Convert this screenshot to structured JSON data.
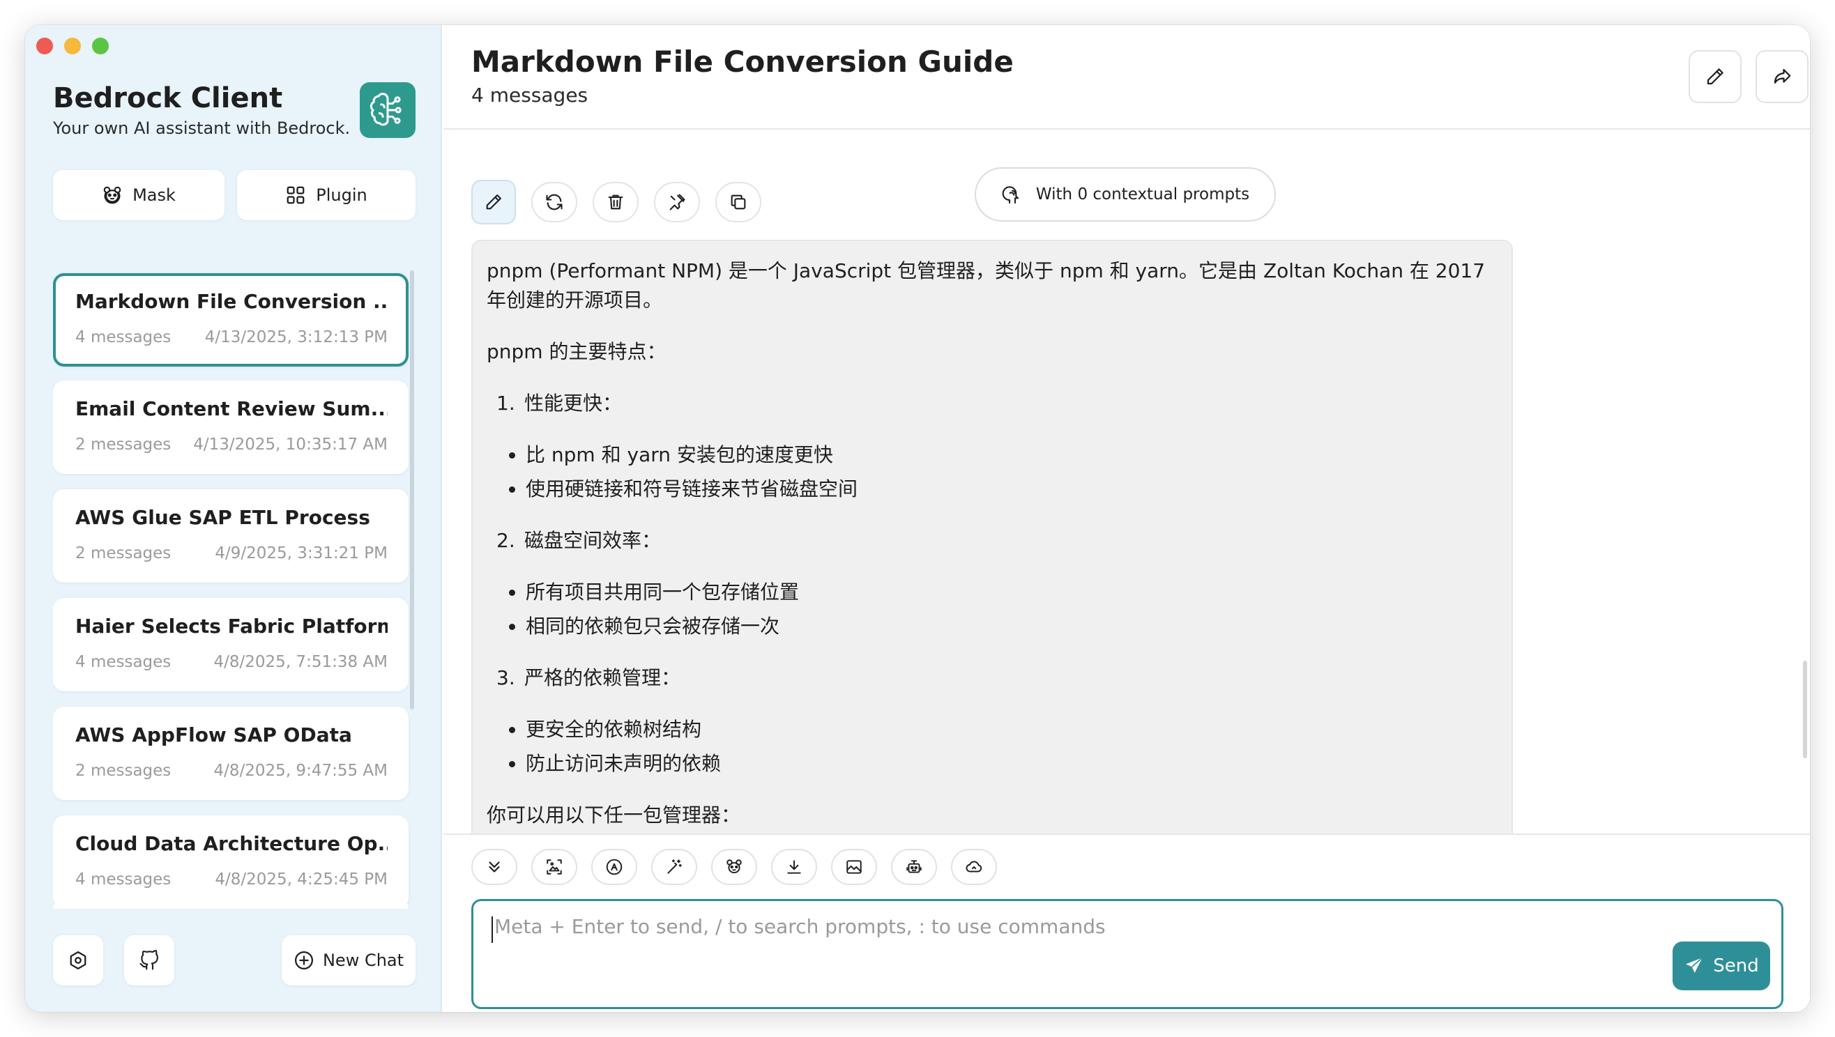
{
  "app": {
    "title": "Bedrock Client",
    "subtitle": "Your own AI assistant with Bedrock."
  },
  "sidebar": {
    "mask_label": "Mask",
    "plugin_label": "Plugin",
    "new_chat_label": "New Chat",
    "chats": [
      {
        "title": "Markdown File Conversion ...",
        "count": "4 messages",
        "date": "4/13/2025, 3:12:13 PM",
        "active": true
      },
      {
        "title": "Email Content Review Sum...",
        "count": "2 messages",
        "date": "4/13/2025, 10:35:17 AM"
      },
      {
        "title": "AWS Glue SAP ETL Process",
        "count": "2 messages",
        "date": "4/9/2025, 3:31:21 PM"
      },
      {
        "title": "Haier Selects Fabric Platform",
        "count": "4 messages",
        "date": "4/8/2025, 7:51:38 AM"
      },
      {
        "title": "AWS AppFlow SAP OData",
        "count": "2 messages",
        "date": "4/8/2025, 9:47:55 AM"
      },
      {
        "title": "Cloud Data Architecture Op...",
        "count": "4 messages",
        "date": "4/8/2025, 4:25:45 PM"
      }
    ]
  },
  "header": {
    "title": "Markdown File Conversion Guide",
    "subtitle": "4 messages"
  },
  "context": {
    "label": "With 0 contextual prompts"
  },
  "message": {
    "p1": "pnpm (Performant NPM) 是一个 JavaScript 包管理器，类似于 npm 和 yarn。它是由 Zoltan Kochan 在 2017 年创建的开源项目。",
    "p2": "pnpm 的主要特点：",
    "s1_num": "1.",
    "s1_title": "性能更快：",
    "s1_items": [
      "比 npm 和 yarn 安装包的速度更快",
      "使用硬链接和符号链接来节省磁盘空间"
    ],
    "s2_num": "2.",
    "s2_title": "磁盘空间效率：",
    "s2_items": [
      "所有项目共用同一个包存储位置",
      "相同的依赖包只会被存储一次"
    ],
    "s3_num": "3.",
    "s3_title": "严格的依赖管理：",
    "s3_items": [
      "更安全的依赖树结构",
      "防止访问未声明的依赖"
    ],
    "p3": "你可以用以下任一包管理器："
  },
  "input": {
    "placeholder": "Meta + Enter to send, / to search prompts, : to use commands",
    "send_label": "Send"
  },
  "colors": {
    "accent": "#2f8f98",
    "sidebar_bg": "#e8f3fa",
    "logo_bg": "#2e9a8e"
  }
}
